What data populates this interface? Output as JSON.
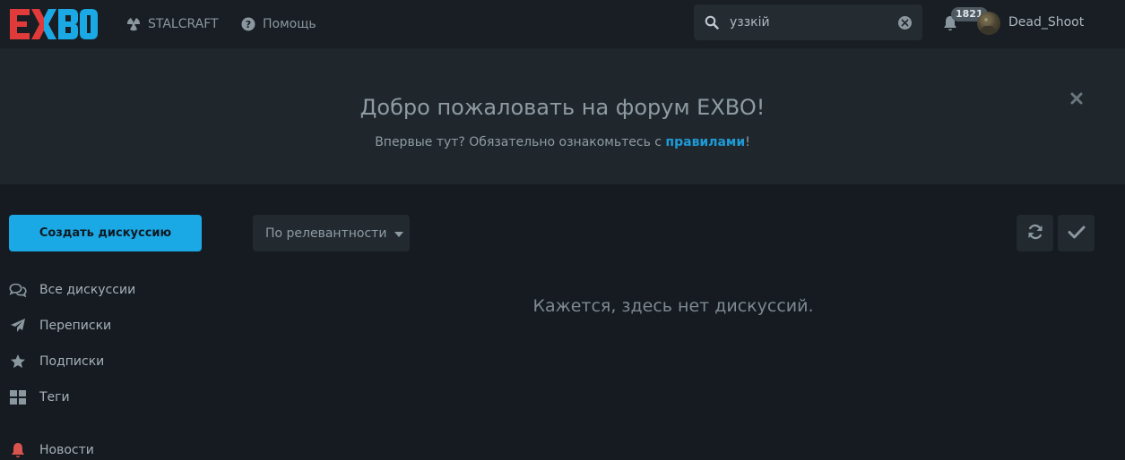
{
  "header": {
    "logo_text": "EXBO",
    "nav": [
      {
        "label": "STALCRAFT",
        "icon": "radiation-icon"
      },
      {
        "label": "Помощь",
        "icon": "question-circle-icon"
      }
    ],
    "search": {
      "value": "уззкій",
      "placeholder": ""
    },
    "notifications": {
      "count": "1821"
    },
    "user": {
      "name": "Dead_Shoot"
    }
  },
  "hero": {
    "title": "Добро пожаловать на форум EXBO!",
    "text_before": "Впервые тут? Обязательно ознакомьтесь с ",
    "link": "правилами",
    "text_after": "!"
  },
  "sidebar": {
    "create_button": "Создать дискуссию",
    "items": [
      {
        "label": "Все дискуссии",
        "icon": "comments-icon"
      },
      {
        "label": "Переписки",
        "icon": "paper-plane-icon"
      },
      {
        "label": "Подписки",
        "icon": "star-icon"
      },
      {
        "label": "Теги",
        "icon": "grid-icon"
      },
      {
        "label": "Новости",
        "icon": "bell-icon"
      }
    ]
  },
  "toolbar": {
    "sort_label": "По релевантности"
  },
  "main": {
    "empty_message": "Кажется, здесь нет дискуссий."
  },
  "colors": {
    "accent": "#1ba9e6",
    "link": "#1e9ad6",
    "news_icon": "#d9534f",
    "logo_red": "#e03a3a",
    "logo_blue": "#1ba9e6"
  }
}
